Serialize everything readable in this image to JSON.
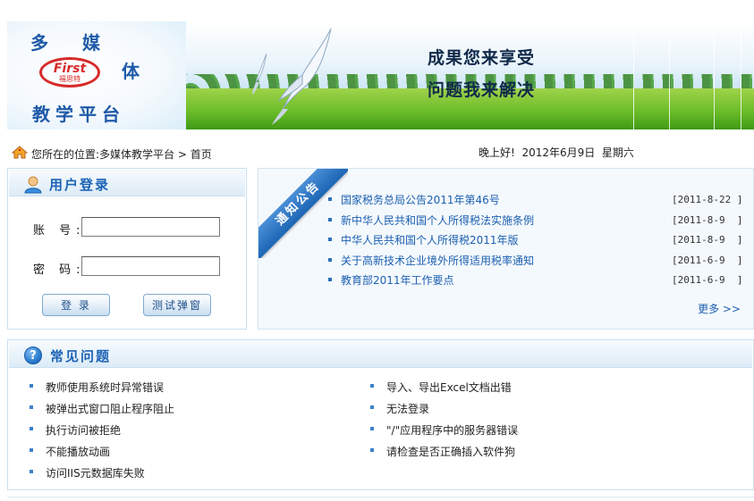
{
  "banner": {
    "logo_char_1": "多",
    "logo_char_2": "媒",
    "logo_char_3": "体",
    "logo_char_4": "教学平台",
    "logo_brand_en": "First",
    "logo_brand_cn": "福思特",
    "slogan_line_1": "成果您来享受",
    "slogan_line_2": "问题我来解决"
  },
  "location": {
    "icon": "home-icon",
    "text": "您所在的位置:多媒体教学平台 > 首页",
    "greeting": "晚上好!  2012年6月9日  星期六"
  },
  "login": {
    "title": "用户登录",
    "icon": "user-icon",
    "account_label": "账 号:",
    "password_label": "密 码:",
    "account_value": "",
    "password_value": "",
    "login_button": "登 录",
    "test_button": "测试弹窗"
  },
  "notice": {
    "ribbon_label": "通知公告",
    "items": [
      {
        "title": "国家税务总局公告2011年第46号",
        "date": "[2011-8-22 ]"
      },
      {
        "title": "新中华人民共和国个人所得税法实施条例",
        "date": "[2011-8-9  ]"
      },
      {
        "title": "中华人民共和国个人所得税2011年版",
        "date": "[2011-8-9  ]"
      },
      {
        "title": "关于高新技术企业境外所得适用税率通知",
        "date": "[2011-6-9  ]"
      },
      {
        "title": "教育部2011年工作要点",
        "date": "[2011-6-9  ]"
      }
    ],
    "more": "更多 >>"
  },
  "faq": {
    "title": "常见问题",
    "icon": "question-icon",
    "left": [
      "教师使用系统时异常错误",
      "被弹出式窗口阻止程序阻止",
      "执行访问被拒绝",
      "不能播放动画",
      "访问IIS元数据库失败"
    ],
    "right": [
      "导入、导出Excel文档出错",
      "无法登录",
      "\"/\"应用程序中的服务器错误",
      "请检查是否正确插入软件狗"
    ]
  },
  "colors": {
    "accent": "#1b63b5",
    "link": "#1b5fb0",
    "border": "#c9dff0"
  }
}
